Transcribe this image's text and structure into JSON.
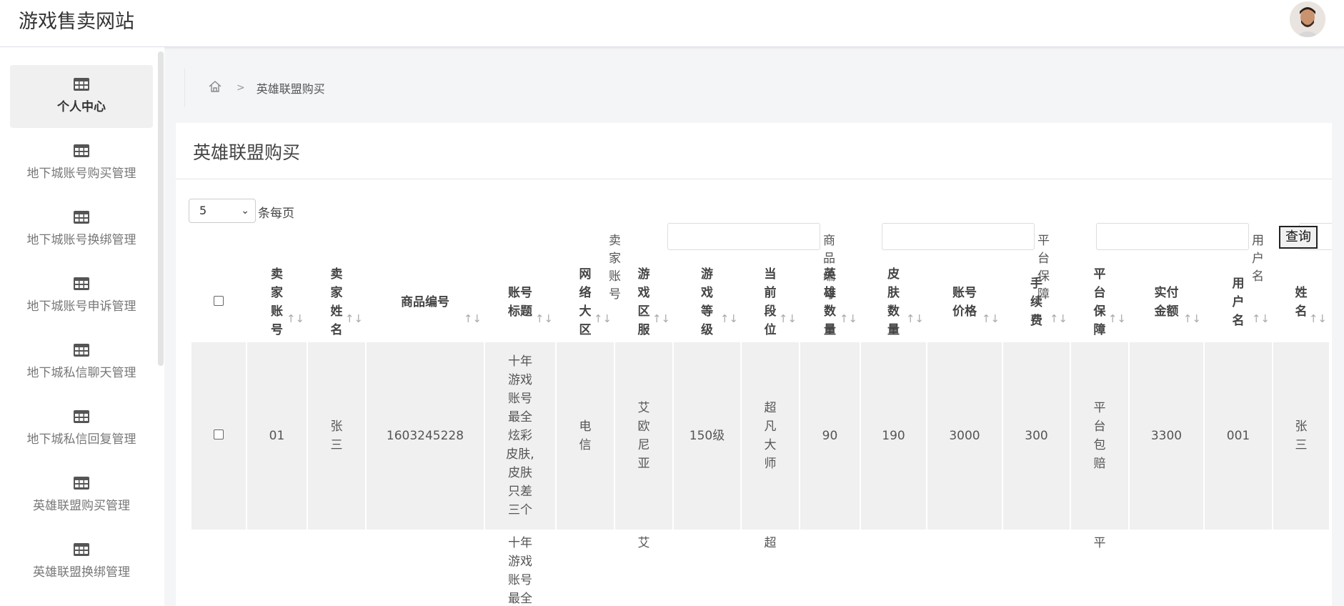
{
  "site": {
    "title": "游戏售卖网站"
  },
  "sidebar": {
    "items": [
      {
        "label": "个人中心",
        "active": true
      },
      {
        "label": "地下城账号购买管理"
      },
      {
        "label": "地下城账号换绑管理"
      },
      {
        "label": "地下城账号申诉管理"
      },
      {
        "label": "地下城私信聊天管理"
      },
      {
        "label": "地下城私信回复管理"
      },
      {
        "label": "英雄联盟购买管理"
      },
      {
        "label": "英雄联盟换绑管理"
      }
    ],
    "icon": "table-icon"
  },
  "breadcrumb": {
    "current": "英雄联盟购买",
    "home_icon": "home-icon"
  },
  "panel": {
    "title": "英雄联盟购买"
  },
  "pagination": {
    "page_size": "5",
    "page_size_label": "条每页"
  },
  "filters": {
    "seller_account": {
      "label": "卖家账号",
      "value": ""
    },
    "product_no": {
      "label": "商品编号",
      "value": ""
    },
    "guarantee": {
      "label": "平台保障",
      "value": ""
    },
    "username": {
      "label": "用户名",
      "value": ""
    },
    "search_label": "查询"
  },
  "table": {
    "sort_glyph": "↑↓",
    "columns": [
      "卖家账号",
      "卖家姓名",
      "商品编号",
      "账号标题",
      "网络大区",
      "游戏区服",
      "游戏等级",
      "当前段位",
      "英雄数量",
      "皮肤数量",
      "账号价格",
      "手续费",
      "平台保障",
      "实付金额",
      "用户名",
      "姓名"
    ],
    "rows": [
      [
        "01",
        "张三",
        "1603245228",
        "十年游戏账号最全炫彩皮肤,皮肤只差三个",
        "电信",
        "艾欧尼亚",
        "150级",
        "超凡大师",
        "90",
        "190",
        "3000",
        "300",
        "平台包赔",
        "3300",
        "001",
        "张三"
      ],
      [
        "",
        "",
        "",
        "十年游戏账号最全",
        "",
        "艾",
        "",
        "超",
        "",
        "",
        "",
        "",
        "平",
        "",
        "",
        ""
      ]
    ]
  }
}
